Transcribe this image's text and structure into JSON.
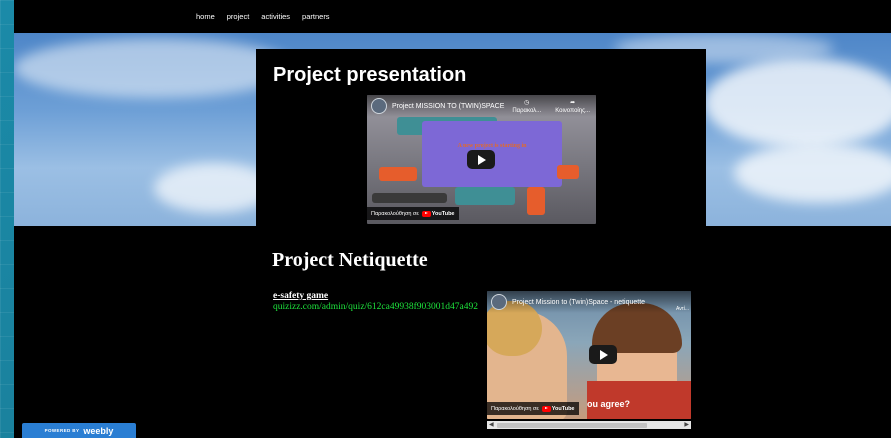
{
  "nav": {
    "items": [
      {
        "label": "home"
      },
      {
        "label": "project"
      },
      {
        "label": "activities"
      },
      {
        "label": "partners"
      }
    ]
  },
  "section1": {
    "title": "Project presentation",
    "video": {
      "title": "Project MISSION TO (TWIN)SPACE",
      "overlay_text": "A new project is starting in",
      "watch_label": "Παρακολούθηση σε",
      "platform": "YouTube",
      "right_label_1": "Παρακολ...",
      "right_label_2": "Κοινοποίης..."
    }
  },
  "section2": {
    "title": "Project Netiquette",
    "link_label": "e-safety game",
    "link_url": "quizizz.com/admin/quiz/612ca49938f903001d47a492",
    "video": {
      "title": "Project Mission to (Twin)Space - netiquette",
      "caption": "ou agree?",
      "watch_label": "Παρακολούθηση σε",
      "platform": "YouTube",
      "side_label": "Αντί..."
    }
  },
  "footer": {
    "powered_by": "POWERED BY",
    "brand": "weebly"
  },
  "colors": {
    "background": "#1f7d99",
    "link_green": "#1ee53d",
    "weebly_blue": "#2a7ed3"
  }
}
